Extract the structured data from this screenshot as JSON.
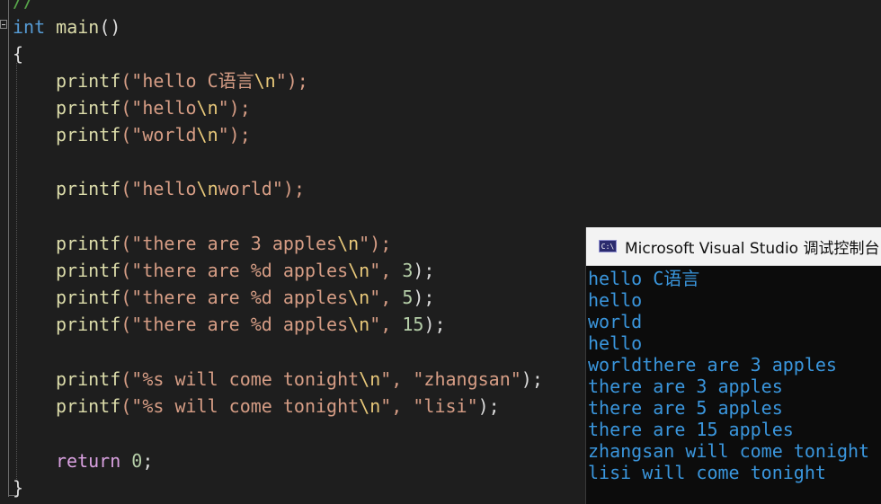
{
  "editor": {
    "top_comment": "//",
    "sig_type": "int",
    "sig_name": "main",
    "sig_parens": "()",
    "open_brace": "{",
    "close_brace": "}",
    "lines": [
      {
        "fn": "printf",
        "pre": "(\"hello C语言",
        "esc": "\\n",
        "post": "\");",
        "args": []
      },
      {
        "fn": "printf",
        "pre": "(\"hello",
        "esc": "\\n",
        "post": "\");"
      },
      {
        "fn": "printf",
        "pre": "(\"world",
        "esc": "\\n",
        "post": "\");"
      },
      {
        "fn": "printf",
        "pre": "(\"hello",
        "esc": "\\n",
        "mid": "world",
        "post": "\");"
      },
      {
        "fn": "printf",
        "pre": "(\"there are 3 apples",
        "esc": "\\n",
        "post": "\");"
      },
      {
        "fn": "printf",
        "pre": "(\"there are %d apples",
        "esc": "\\n",
        "post": "\", ",
        "num": "3",
        "end": ");"
      },
      {
        "fn": "printf",
        "pre": "(\"there are %d apples",
        "esc": "\\n",
        "post": "\", ",
        "num": "5",
        "end": ");"
      },
      {
        "fn": "printf",
        "pre": "(\"there are %d apples",
        "esc": "\\n",
        "post": "\", ",
        "num": "15",
        "end": ");"
      },
      {
        "fn": "printf",
        "pre": "(\"%s will come tonight",
        "esc": "\\n",
        "post": "\", ",
        "arg": "\"zhangsan\"",
        "end": ");"
      },
      {
        "fn": "printf",
        "pre": "(\"%s will come tonight",
        "esc": "\\n",
        "post": "\", ",
        "arg": "\"lisi\"",
        "end": ");"
      }
    ],
    "return_kw": "return",
    "return_val": "0",
    "return_end": ";"
  },
  "console": {
    "title": "Microsoft Visual Studio 调试控制台",
    "icon": "console-app-icon",
    "icon_text": "C:\\",
    "output": [
      "hello C语言",
      "hello",
      "world",
      "hello",
      "worldthere are 3 apples",
      "there are 3 apples",
      "there are 5 apples",
      "there are 15 apples",
      "zhangsan will come tonight",
      "lisi will come tonight"
    ]
  },
  "colors": {
    "background": "#1e1e1e",
    "keyword": "#569cd6",
    "function": "#dcdcaa",
    "string": "#d69d85",
    "escape": "#e8c87a",
    "number": "#b5cea8",
    "return_keyword": "#d8a0df",
    "console_text": "#3a96dd"
  }
}
